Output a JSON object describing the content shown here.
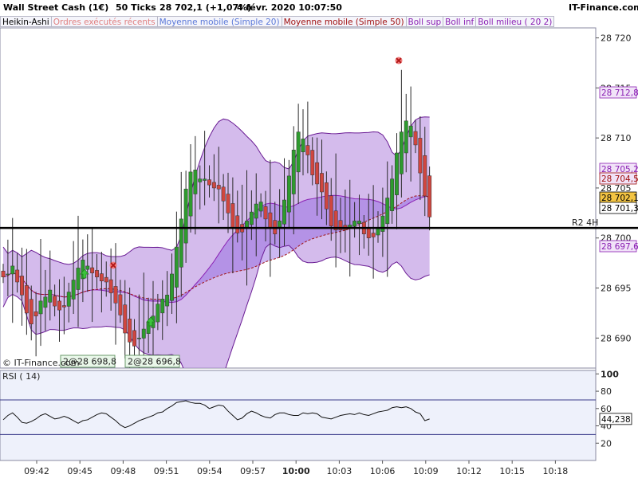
{
  "header": {
    "instrument": "Wall Street Cash (1€)",
    "period": "50 Ticks",
    "quote": "28 702,1 (+1,07%)",
    "datetime": "4 févr. 2020 10:07:50",
    "brand": "IT-Finance.com"
  },
  "legend": [
    {
      "label": "Heikin-Ashi",
      "color": "#000000"
    },
    {
      "label": "Ordres exécutés récents",
      "color": "#e08080"
    },
    {
      "label": "Moyenne mobile (Simple 20)",
      "color": "#5a78d8"
    },
    {
      "label": "Moyenne mobile (Simple 50)",
      "color": "#a01010"
    },
    {
      "label": "Boll sup",
      "color": "#8a1fb3"
    },
    {
      "label": "Boll inf",
      "color": "#8a1fb3"
    },
    {
      "label": "Boll milieu ( 20 2)",
      "color": "#8a1fb3"
    }
  ],
  "watermark": "© IT-Finance.com",
  "rsi_label": "RSI ( 14)",
  "chart_data": [
    {
      "type": "candlestick",
      "title": "Wall Street Cash (1€)",
      "ylim": [
        28687,
        28721
      ],
      "yticks": [
        28690,
        28695,
        28700,
        28705,
        28710,
        28715,
        28720
      ],
      "ytick_labels": [
        "28 690",
        "28 695",
        "28 700",
        "28 705",
        "28 710",
        "28 715",
        "28 720"
      ],
      "xticks": [
        "09:42",
        "09:45",
        "09:48",
        "09:51",
        "09:54",
        "09:57",
        "10:00",
        "10:03",
        "10:06",
        "10:09",
        "10:12",
        "10:15",
        "10:18"
      ],
      "candle_count": 92,
      "close": [
        28696.1,
        28696.4,
        28697.2,
        28695.6,
        28694.3,
        28692.5,
        28691.4,
        28692.2,
        28693.7,
        28694.1,
        28694.8,
        28693.2,
        28692.8,
        28693.1,
        28694.6,
        28695.8,
        28697.0,
        28697.8,
        28697.2,
        28696.5,
        28696.1,
        28695.7,
        28695.6,
        28694.5,
        28693.5,
        28692.3,
        28690.5,
        28689.6,
        28689.2,
        28690.0,
        28690.9,
        28691.6,
        28692.2,
        28693.4,
        28693.9,
        28694.3,
        28696.4,
        28699.1,
        28701.9,
        28704.9,
        28706.6,
        28706.8,
        28705.9,
        28705.9,
        28705.3,
        28705.0,
        28704.9,
        28703.7,
        28702.5,
        28701.0,
        28700.5,
        28700.6,
        28701.7,
        28702.6,
        28703.4,
        28703.6,
        28701.9,
        28701.0,
        28700.4,
        28701.7,
        28703.8,
        28706.2,
        28708.8,
        28710.6,
        28709.9,
        28708.3,
        28706.3,
        28705.4,
        28704.6,
        28702.9,
        28701.2,
        28700.8,
        28700.8,
        28700.8,
        28701.3,
        28701.7,
        28701.7,
        28700.4,
        28700.0,
        28700.1,
        28701.0,
        28702.2,
        28704.0,
        28705.9,
        28708.5,
        28710.6,
        28711.7,
        28711.2,
        28709.3,
        28706.5,
        28704.2,
        28702.1
      ],
      "annotations": [
        "2@28 698,8",
        "2@28 696,8"
      ],
      "reference_line": {
        "label": "R2 4H",
        "y": 28701
      }
    },
    {
      "type": "line",
      "title": "RSI ( 14)",
      "ylim": [
        0,
        104
      ],
      "yticks": [
        20,
        40,
        60,
        80,
        100
      ],
      "ytick_labels": [
        "20",
        "40",
        "60",
        "80",
        "100"
      ],
      "levels": [
        70,
        30
      ],
      "values": [
        47,
        52,
        55,
        50,
        44,
        43,
        45,
        48,
        52,
        54,
        51,
        48,
        49,
        51,
        49,
        46,
        43,
        46,
        47,
        50,
        53,
        55,
        54,
        50,
        46,
        41,
        38,
        40,
        43,
        46,
        48,
        50,
        52,
        55,
        56,
        60,
        63,
        67,
        68,
        69,
        67,
        66,
        66,
        64,
        60,
        62,
        64,
        63,
        57,
        52,
        47,
        49,
        54,
        57,
        55,
        52,
        50,
        49,
        53,
        55,
        55,
        53,
        52,
        52,
        55,
        54,
        55,
        54,
        50,
        49,
        48,
        50,
        52,
        53,
        54,
        53,
        55,
        53,
        52,
        54,
        56,
        57,
        58,
        61,
        62,
        61,
        62,
        60,
        56,
        54,
        46,
        48
      ],
      "last_value": "44,238"
    }
  ],
  "price_boxes": [
    {
      "label": "28 712,8",
      "color": "#8a1fb3",
      "bg": "#f1e3f8"
    },
    {
      "label": "28 705,2",
      "color": "#8a1fb3",
      "bg": "#f1e3f8"
    },
    {
      "label": "28 704,5",
      "color": "#a01010",
      "bg": "#f1e3f8"
    },
    {
      "label": "28 702,1",
      "color": "#000000",
      "bg": "#f3c443"
    },
    {
      "label": "28 701,3",
      "color": "#000000",
      "bg": "#ffffff"
    },
    {
      "label": "28 697,6",
      "color": "#8a1fb3",
      "bg": "#f1e3f8"
    }
  ],
  "colors": {
    "bull": "#2e9b2e",
    "bear": "#d0463f",
    "band_fill": "#b78ee0",
    "sma20": "#5a78d8",
    "sma50": "#a01010",
    "plot_bg": "#eef1fb"
  }
}
